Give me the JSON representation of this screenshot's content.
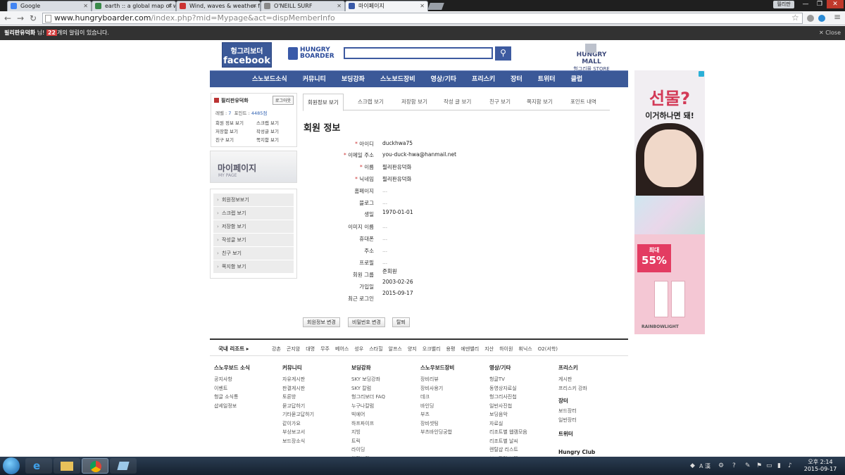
{
  "browser": {
    "tabs": [
      {
        "title": "Google"
      },
      {
        "title": "earth :: a global map of wi"
      },
      {
        "title": "Wind, waves & weather fo"
      },
      {
        "title": "O'NEILL SURF"
      },
      {
        "title": "마이페이지"
      }
    ],
    "user_badge": "필리판",
    "url_domain": "www.hungryboarder.com",
    "url_path": "/index.php?mid=Mypage&act=dispMemberInfo"
  },
  "notification": {
    "user": "필리판유덕화",
    "suffix_user": " 님!",
    "count": "22",
    "message": "개의 알림이 있습니다.",
    "close_label": "✕ Close"
  },
  "header": {
    "facebook_line1": "헝그리보더",
    "facebook_line2": "facebook",
    "logo_line1": "HUNGRY",
    "logo_line2": "BOARDER",
    "search_placeholder": "",
    "mall_line1": "HUNGRY MALL",
    "mall_line2": "헝그리몰 STORE"
  },
  "nav": [
    "스노보드소식",
    "커뮤니티",
    "보딩강좌",
    "스노보드장비",
    "영상/기타",
    "프리스키",
    "장터",
    "트위터",
    "클럽"
  ],
  "userbox": {
    "name": "필리판유덕화",
    "logout": "로그아웃",
    "level_label": "레벨 :",
    "level_value": "7",
    "points_label": "포인트 :",
    "points_value": "4485점",
    "links": [
      "회원 정보 보기",
      "스크랩 보기",
      "저장함 보기",
      "작성글 보기",
      "친구 보기",
      "쪽지함 보기"
    ]
  },
  "mypage_banner": {
    "title": "마이페이지",
    "subtitle": "MY PAGE"
  },
  "side_menu": [
    "회원정보보기",
    "스크랩 보기",
    "저장함 보기",
    "작성글 보기",
    "친구 보기",
    "쪽지함 보기"
  ],
  "tabs": [
    "회원정보 보기",
    "스크랩 보기",
    "저장함 보기",
    "작성 글 보기",
    "친구 보기",
    "쪽지함 보기",
    "포인트 내역"
  ],
  "page_title": "회원 정보",
  "fields": [
    {
      "label": "아이디",
      "required": true,
      "value": "duckhwa75"
    },
    {
      "label": "이메일 주소",
      "required": true,
      "value": "you-duck-hwa@hanmail.net"
    },
    {
      "label": "이름",
      "required": true,
      "value": "필리판유덕화"
    },
    {
      "label": "닉네임",
      "required": true,
      "value": "필리판유덕화"
    },
    {
      "label": "홈페이지",
      "required": false,
      "value": "..."
    },
    {
      "label": "블로그",
      "required": false,
      "value": "..."
    },
    {
      "label": "생일",
      "required": false,
      "value": "1970-01-01"
    },
    {
      "label": "이미지 이름",
      "required": false,
      "value": "..."
    },
    {
      "label": "휴대폰",
      "required": false,
      "value": "..."
    },
    {
      "label": "주소",
      "required": false,
      "value": "..."
    },
    {
      "label": "프로필",
      "required": false,
      "value": "..."
    },
    {
      "label": "회원 그룹",
      "required": false,
      "value": "준회원"
    },
    {
      "label": "가입일",
      "required": false,
      "value": "2003-02-26"
    },
    {
      "label": "최근 로그인",
      "required": false,
      "value": "2015-09-17"
    }
  ],
  "actions": [
    "회원정보 변경",
    "비밀번호 변경",
    "탈퇴"
  ],
  "ad": {
    "headline": "선물?",
    "subline": "이거하나면 돼!",
    "sale_label": "최대",
    "sale_value": "55%",
    "brand": "RAINBOWLIGHT"
  },
  "footer": {
    "resort_title": "국내 리조트 ▸",
    "resorts": [
      "강촌",
      "곤지암",
      "대명",
      "무주",
      "베어스",
      "성우",
      "스타힐",
      "알프스",
      "양지",
      "오크밸리",
      "용평",
      "에덴밸리",
      "지산",
      "하이원",
      "휘닉스",
      "O2(서학)"
    ],
    "columns": [
      {
        "title": "스노우보드 소식",
        "items": [
          "공지사항",
          "이벤트",
          "헝글 소식통",
          "샵세일정보"
        ]
      },
      {
        "title": "커뮤니티",
        "items": [
          "자유게시판",
          "판결게시판",
          "토론방",
          "묻고답하기",
          "기타묻고답하기",
          "같이가요",
          "부상보고서",
          "보드장소식"
        ]
      },
      {
        "title": "보딩강좌",
        "items": [
          "SKY 보딩강좌",
          "SKY 칼럼",
          "헝그리보더 FAQ",
          "누구나칼럼",
          "빅에어",
          "하프파이프",
          "지빙",
          "트릭",
          "라이딩",
          "안전보딩"
        ]
      },
      {
        "title": "스노우보드장비",
        "items": [
          "장비리뷰",
          "장비사용기",
          "데크",
          "바인딩",
          "부츠",
          "장비셋팅",
          "부츠바인딩궁합"
        ]
      },
      {
        "title": "영상/기타",
        "items": [
          "헝글TV",
          "동영상자료실",
          "헝그리사진첩",
          "일반사진첩",
          "보딩음악",
          "자료실",
          "리조트별 웹캠모음",
          "리조트별 날씨",
          "렌탈샵 리스트",
          "보드관련 브랜드"
        ]
      },
      {
        "title": "프리스키",
        "items": [
          "게시판",
          "프리스키 강좌"
        ],
        "title2": "장터",
        "items2": [
          "보드장터",
          "일반장터"
        ],
        "title3": "트위터",
        "title4": "Hungry Club"
      }
    ]
  },
  "taskbar": {
    "time": "오후 2:14",
    "date": "2015-09-17",
    "ime": "A 漢"
  }
}
